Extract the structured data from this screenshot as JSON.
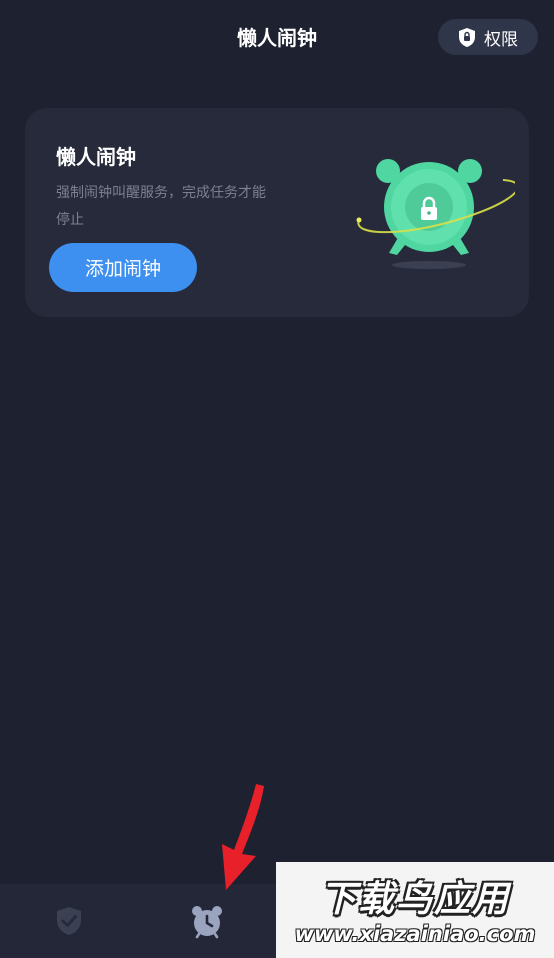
{
  "header": {
    "title": "懒人闹钟",
    "permission_button": {
      "label": "权限",
      "icon": "shield-lock-icon"
    }
  },
  "card": {
    "title": "懒人闹钟",
    "description": "强制闹钟叫醒服务，完成任务才能停止",
    "add_button_label": "添加闹钟",
    "illustration": "alarm-clock-lock-illustration"
  },
  "bottom_nav": {
    "items": [
      {
        "icon": "shield-check-icon",
        "active": false
      },
      {
        "icon": "alarm-clock-icon",
        "active": true
      }
    ]
  },
  "watermark": {
    "title": "下载鸟应用",
    "url": "www.xiazainiao.com"
  },
  "colors": {
    "background": "#1e2130",
    "card": "#262a3a",
    "accent_blue": "#3d8ff0",
    "clock_green": "#4fd6a1",
    "arrow_red": "#e8202a"
  }
}
